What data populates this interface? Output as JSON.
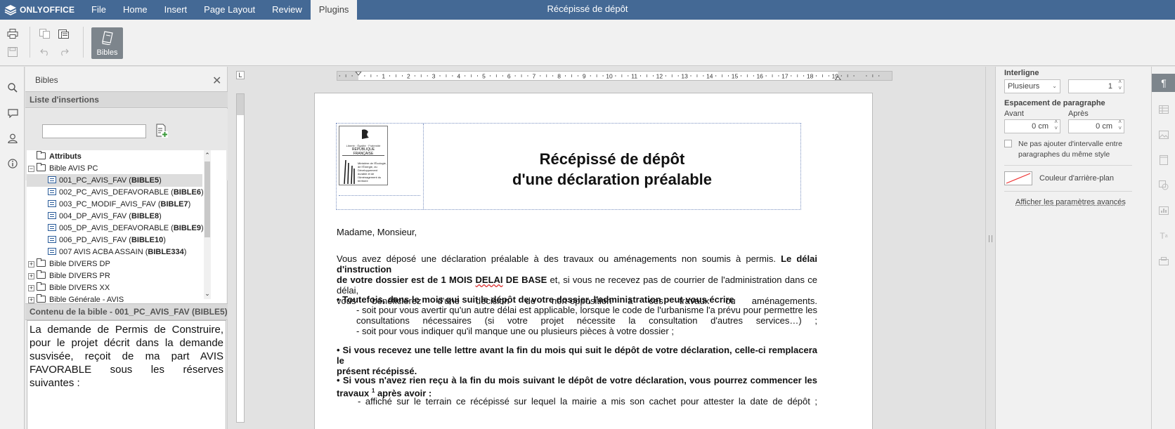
{
  "app": {
    "brand": "ONLYOFFICE",
    "doc_title": "Récépissé de dépôt"
  },
  "menu": {
    "tabs": [
      "File",
      "Home",
      "Insert",
      "Page Layout",
      "Review",
      "Plugins"
    ],
    "active": "Plugins"
  },
  "toolbar": {
    "bibles_label": "Bibles"
  },
  "plugin": {
    "title": "Bibles",
    "list_header": "Liste d'insertions",
    "search_placeholder": "",
    "tree": [
      {
        "label": "Attributs",
        "type": "folder",
        "level": 0,
        "toggle": ""
      },
      {
        "label": "Bible AVIS PC",
        "type": "folder",
        "level": 0,
        "toggle": "−"
      },
      {
        "name": "001_PC_AVIS_FAV",
        "code": "BIBLE5",
        "type": "doc",
        "level": 1,
        "selected": true
      },
      {
        "name": "002_PC_AVIS_DEFAVORABLE",
        "code": "BIBLE6",
        "type": "doc",
        "level": 1
      },
      {
        "name": "003_PC_MODIF_AVIS_FAV",
        "code": "BIBLE7",
        "type": "doc",
        "level": 1
      },
      {
        "name": "004_DP_AVIS_FAV",
        "code": "BIBLE8",
        "type": "doc",
        "level": 1
      },
      {
        "name": "005_DP_AVIS_DEFAVORABLE",
        "code": "BIBLE9",
        "type": "doc",
        "level": 1
      },
      {
        "name": "006_PD_AVIS_FAV",
        "code": "BIBLE10",
        "type": "doc",
        "level": 1
      },
      {
        "name": "007 AVIS ACBA ASSAIN",
        "code": "BIBLE334",
        "type": "doc",
        "level": 1
      },
      {
        "label": "Bible DIVERS DP",
        "type": "folder",
        "level": 0,
        "toggle": "+"
      },
      {
        "label": "Bible DIVERS PR",
        "type": "folder",
        "level": 0,
        "toggle": "+"
      },
      {
        "label": "Bible DIVERS XX",
        "type": "folder",
        "level": 0,
        "toggle": "+"
      },
      {
        "label": "Bible Générale - AVIS",
        "type": "folder",
        "level": 0,
        "toggle": "+"
      }
    ],
    "content_header": "Contenu de la bible - 001_PC_AVIS_FAV (BIBLE5)",
    "content_text": "La demande de Permis de Construire, pour le projet décrit dans la demande susvisée, reçoit de ma part AVIS FAVORABLE sous les réserves suivantes :"
  },
  "ruler": {
    "ticks": [
      "1",
      "2",
      "3",
      "4",
      "5",
      "6",
      "7",
      "8",
      "9",
      "10",
      "11",
      "12",
      "13",
      "14",
      "15",
      "16",
      "17",
      "18",
      "19"
    ]
  },
  "document": {
    "logo": {
      "line1": "Liberté · Égalité · Fraternité",
      "line2": "RÉPUBLIQUE FRANÇAISE",
      "ministry": "Ministère de l'Écologie, de l'Énergie, du Développement durable et de l'Aménagement du territoire"
    },
    "title_line1": "Récépissé de dépôt",
    "title_line2": "d'une déclaration préalable",
    "greeting": "Madame, Monsieur,",
    "p1_a": "Vous avez déposé une déclaration préalable à des travaux ou aménagements non soumis à permis. ",
    "p1_b": "Le délai d'instruction",
    "p1_c": "de votre dossier est de 1 MOIS ",
    "p1_d": "DELAI",
    "p1_e": " DE BASE",
    "p1_f": " et, si vous ne recevez pas de courrier de l'administration dans ce délai,",
    "p1_g": "vous bénéficierez d'une décision de non-opposition à ces travaux ou aménagements.",
    "b1": "• Toutefois, dans le mois qui suit le dépôt de votre dossier, l'administration peut vous écrire",
    "b1_l1": "- soit pour vous avertir qu'un autre délai est applicable, lorsque le code de l'urbanisme l'a prévu pour permettre les",
    "b1_l2": "consultations nécessaires (si votre projet nécessite la consultation d'autres services…) ;",
    "b1_l3": "- soit pour vous indiquer qu'il manque une ou plusieurs pièces à votre dossier ;",
    "b2_l1": "• Si vous recevez une telle lettre avant la fin du mois qui suit le dépôt de votre déclaration, celle-ci remplacera le",
    "b2_l2": "présent récépissé.",
    "b3_l1": "• Si vous n'avez rien reçu à la fin du mois suivant le dépôt de votre déclaration, vous pourrez commencer les",
    "b3_l2a": "travaux ",
    "b3_sup": "1",
    "b3_l2b": " après avoir :",
    "b3_l3": "- affiché sur le terrain ce récépissé sur lequel la mairie a mis son cachet pour attester la date de dépôt ;"
  },
  "right_panel": {
    "line_spacing_label": "Interligne",
    "line_spacing_mode": "Plusieurs",
    "line_spacing_value": "1",
    "para_spacing_label": "Espacement de paragraphe",
    "before_label": "Avant",
    "after_label": "Après",
    "before_value": "0 cm",
    "after_value": "0 cm",
    "no_interval_label": "Ne pas ajouter d'intervalle entre paragraphes du même style",
    "bg_color_label": "Couleur d'arrière-plan",
    "advanced_link": "Afficher les paramètres avancés"
  },
  "colors": {
    "header": "#446995",
    "panel": "#f1f1f1",
    "canvas": "#e2e2e2"
  }
}
